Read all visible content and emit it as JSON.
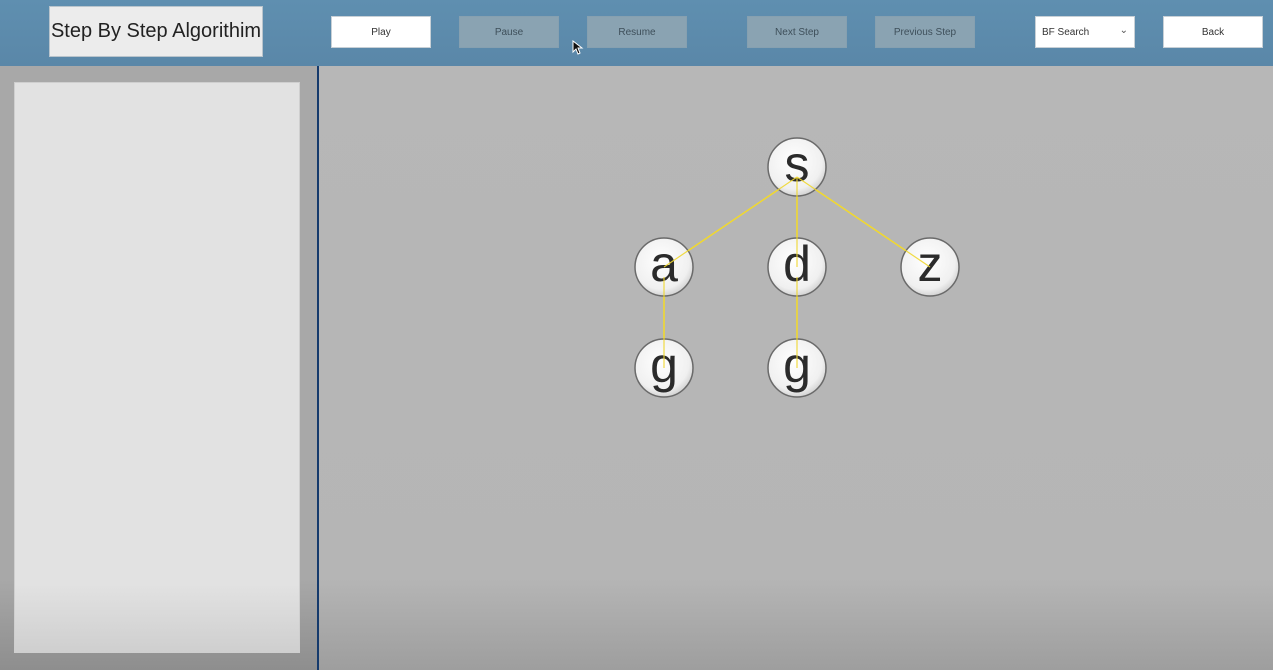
{
  "title": "Step By Step Algorithim",
  "buttons": {
    "play": "Play",
    "pause": "Pause",
    "resume": "Resume",
    "next_step": "Next Step",
    "previous_step": "Previous Step",
    "back": "Back"
  },
  "algorithm_select": {
    "selected": "BF Search"
  },
  "colors": {
    "header": "#5f8fb0",
    "edge": "#f0d830",
    "disabled_button": "#8aa3b2",
    "divider": "#153a6c"
  },
  "tree": {
    "nodes": [
      {
        "id": "s",
        "label": "s"
      },
      {
        "id": "a",
        "label": "a"
      },
      {
        "id": "d",
        "label": "d"
      },
      {
        "id": "z",
        "label": "z"
      },
      {
        "id": "g1",
        "label": "g"
      },
      {
        "id": "g2",
        "label": "g"
      }
    ],
    "edges": [
      [
        "s",
        "a"
      ],
      [
        "s",
        "d"
      ],
      [
        "s",
        "z"
      ],
      [
        "a",
        "g1"
      ],
      [
        "d",
        "g2"
      ]
    ]
  }
}
